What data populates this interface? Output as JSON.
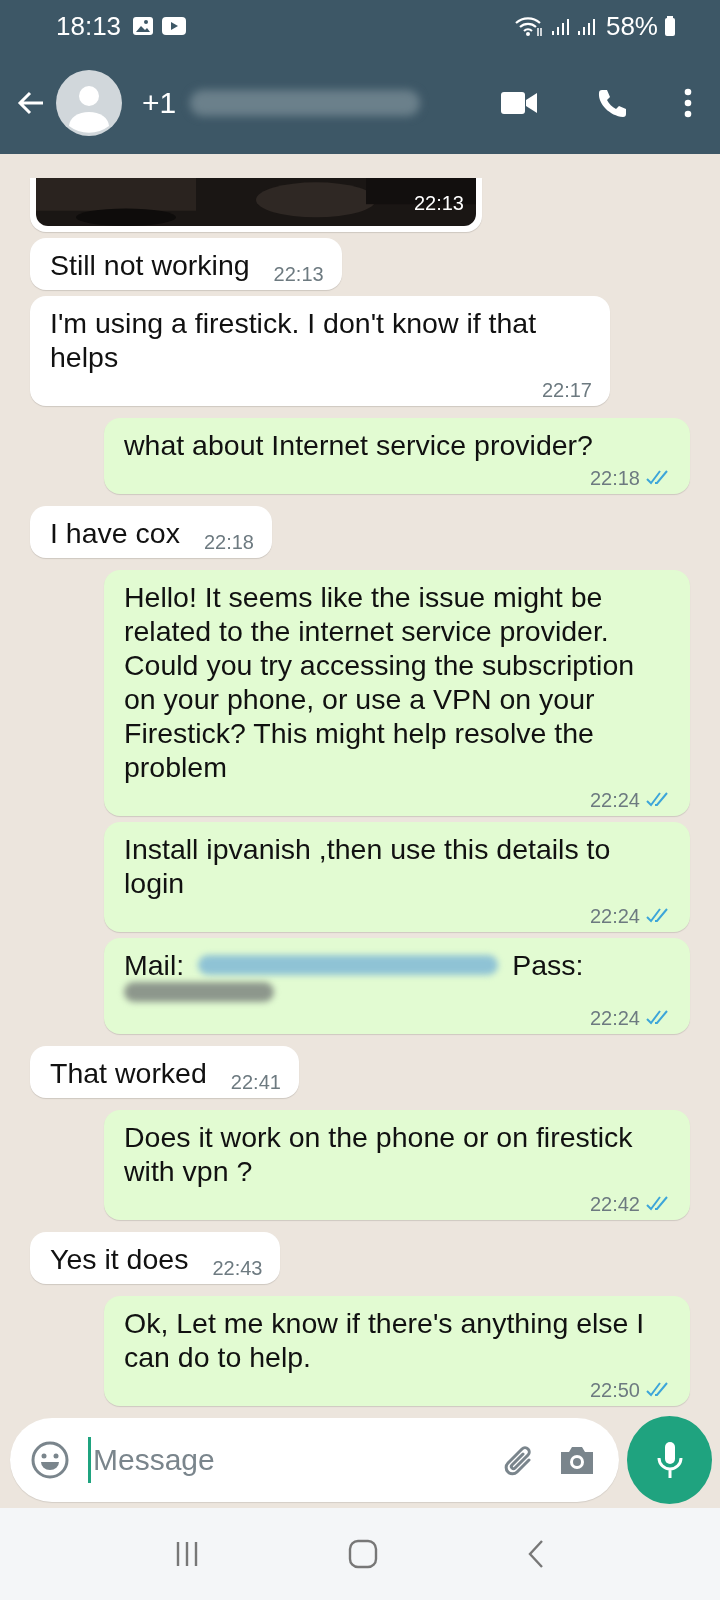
{
  "status_bar": {
    "time": "18:13",
    "battery": "58%"
  },
  "header": {
    "contact_prefix": "+1"
  },
  "messages": [
    {
      "time": "22:13"
    },
    {
      "kind": "received",
      "text": "Still not working",
      "time": "22:13"
    },
    {
      "kind": "received",
      "text": "I'm using a firestick. I don't know if that helps",
      "time": "22:17"
    },
    {
      "kind": "sent",
      "text": "what about Internet service provider?",
      "time": "22:18",
      "read": true
    },
    {
      "kind": "received",
      "text": "I have cox",
      "time": "22:18"
    },
    {
      "kind": "sent",
      "text": "Hello! It seems like the issue might be related to the internet service provider. Could you try accessing the subscription on your phone, or use a VPN on your Firestick? This might help resolve the problem",
      "time": "22:24",
      "read": true
    },
    {
      "kind": "sent",
      "text": "Install ipvanish ,then use this details to login",
      "time": "22:24",
      "read": true
    },
    {
      "kind": "sent",
      "segments": [
        {
          "kind": "text",
          "text": "Mail:"
        },
        {
          "kind": "blur-link"
        },
        {
          "kind": "text",
          "text": "Pass:"
        },
        {
          "kind": "blur-plain"
        }
      ],
      "time": "22:24",
      "read": true
    },
    {
      "kind": "received",
      "text": "That worked",
      "time": "22:41"
    },
    {
      "kind": "sent",
      "text": "Does it work on the phone or on firestick with vpn ?",
      "time": "22:42",
      "read": true
    },
    {
      "kind": "received",
      "text": "Yes it does",
      "time": "22:43"
    },
    {
      "kind": "sent",
      "text": "Ok, Let me know if there's anything else I can do to help.",
      "time": "22:50",
      "read": true
    }
  ],
  "composer": {
    "placeholder": "Message"
  }
}
